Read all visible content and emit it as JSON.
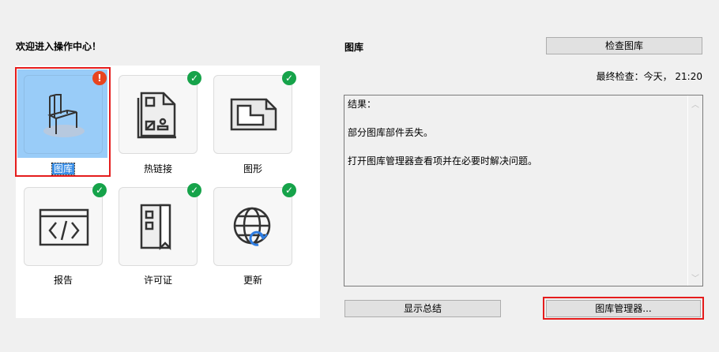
{
  "welcome": "欢迎进入操作中心！",
  "tiles": [
    {
      "label": "图库",
      "status": "error",
      "icon": "chair-icon"
    },
    {
      "label": "热链接",
      "status": "ok",
      "icon": "hotlink-icon"
    },
    {
      "label": "图形",
      "status": "ok",
      "icon": "drawing-icon"
    },
    {
      "label": "报告",
      "status": "ok",
      "icon": "code-report-icon"
    },
    {
      "label": "许可证",
      "status": "ok",
      "icon": "license-icon"
    },
    {
      "label": "更新",
      "status": "ok",
      "icon": "globe-update-icon"
    }
  ],
  "badges": {
    "error": "!",
    "ok": "✓"
  },
  "right": {
    "title": "图库",
    "check_button": "检查图库",
    "last_check": "最终检查：今天， 21:20",
    "result_lines": [
      "结果：",
      "",
      "部分图库部件丢失。",
      "",
      "打开图库管理器查看项并在必要时解决问题。"
    ],
    "summary_button": "显示总结",
    "manager_button": "图库管理器..."
  }
}
